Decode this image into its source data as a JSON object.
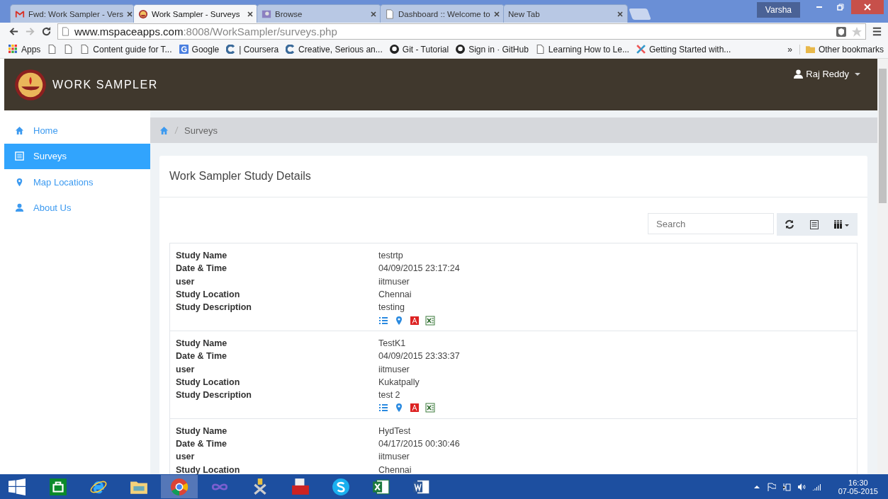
{
  "browser": {
    "tabs": [
      {
        "title": "Fwd: Work Sampler - Vers",
        "kind": "mail",
        "selected": false
      },
      {
        "title": "Work Sampler - Surveys",
        "kind": "logo",
        "selected": true
      },
      {
        "title": "Browse",
        "kind": "picture",
        "selected": false
      },
      {
        "title": "Dashboard :: Welcome to",
        "kind": "page",
        "selected": false
      },
      {
        "title": "New Tab",
        "kind": "blank",
        "selected": false
      }
    ],
    "profile": "Varsha",
    "url_host": "www.mspaceapps.com",
    "url_rest": ":8008/WorkSampler/surveys.php",
    "bookmarks": [
      {
        "label": "Apps",
        "kind": "grid"
      },
      {
        "kind": "page"
      },
      {
        "kind": "page"
      },
      {
        "label": "Content guide for T...",
        "kind": "page"
      },
      {
        "label": "Google",
        "kind": "g"
      },
      {
        "label": "| Coursera",
        "kind": "c"
      },
      {
        "label": "Creative, Serious an...",
        "kind": "c"
      },
      {
        "label": "Git - Tutorial",
        "kind": "dark"
      },
      {
        "label": "Sign in · GitHub",
        "kind": "dark"
      },
      {
        "label": "Learning How to Le...",
        "kind": "page"
      },
      {
        "label": "Getting Started with...",
        "kind": "x"
      }
    ],
    "overflow": "»",
    "other_bookmarks": "Other bookmarks"
  },
  "app": {
    "title": "WORK SAMPLER",
    "user": "Raj Reddy",
    "nav": [
      {
        "label": "Home",
        "kind": "home",
        "selected": false
      },
      {
        "label": "Surveys",
        "kind": "list",
        "selected": true
      },
      {
        "label": "Map Locations",
        "kind": "pin",
        "selected": false
      },
      {
        "label": "About Us",
        "kind": "user",
        "selected": false
      }
    ],
    "breadcrumb": [
      "Surveys"
    ],
    "panel_title": "Work Sampler Study Details",
    "search": {
      "placeholder": "Search"
    },
    "studies": [
      {
        "fields": [
          [
            "Study Name",
            "testrtp"
          ],
          [
            "Date & Time",
            "04/09/2015 23:17:24"
          ],
          [
            "user",
            "iitmuser"
          ],
          [
            "Study Location",
            "Chennai"
          ],
          [
            "Study Description",
            "testing"
          ]
        ],
        "actions": true
      },
      {
        "fields": [
          [
            "Study Name",
            "TestK1"
          ],
          [
            "Date & Time",
            "04/09/2015 23:33:37"
          ],
          [
            "user",
            "iitmuser"
          ],
          [
            "Study Location",
            "Kukatpally"
          ],
          [
            "Study Description",
            "test 2"
          ]
        ],
        "actions": true
      },
      {
        "fields": [
          [
            "Study Name",
            "HydTest"
          ],
          [
            "Date & Time",
            "04/17/2015 00:30:46"
          ],
          [
            "user",
            "iitmuser"
          ],
          [
            "Study Location",
            "Chennai"
          ]
        ],
        "actions": false
      }
    ]
  },
  "taskbar": {
    "items": [
      {
        "kind": "store",
        "selected": false
      },
      {
        "kind": "ie",
        "selected": false
      },
      {
        "kind": "folder",
        "selected": false
      },
      {
        "kind": "chrome",
        "selected": true
      },
      {
        "kind": "infinity",
        "selected": false
      },
      {
        "kind": "tools",
        "selected": false
      },
      {
        "kind": "toolbox",
        "selected": false
      },
      {
        "kind": "skype",
        "selected": false
      },
      {
        "kind": "excel",
        "selected": false
      },
      {
        "kind": "word",
        "selected": false
      }
    ],
    "time": "16:30",
    "date": "07-05-2015"
  }
}
